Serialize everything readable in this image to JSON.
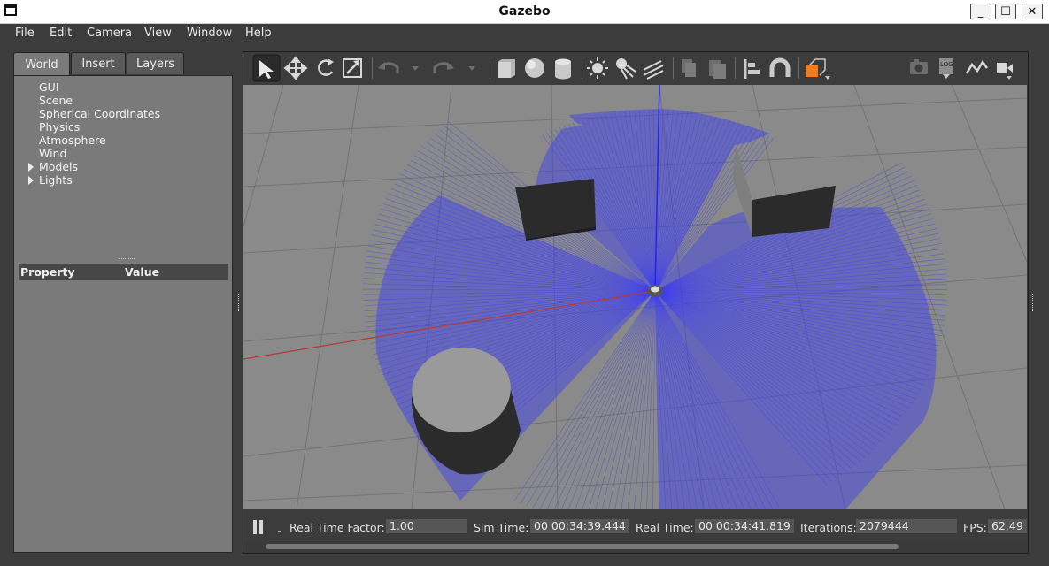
{
  "window": {
    "title": "Gazebo",
    "minimize_label": "_",
    "maximize_label": "☐",
    "close_label": "✕"
  },
  "menubar": {
    "items": [
      "File",
      "Edit",
      "Camera",
      "View",
      "Window",
      "Help"
    ]
  },
  "left_panel": {
    "tabs": [
      "World",
      "Insert",
      "Layers"
    ],
    "active_tab": "World",
    "tree": [
      "GUI",
      "Scene",
      "Spherical Coordinates",
      "Physics",
      "Atmosphere",
      "Wind",
      "Models",
      "Lights"
    ],
    "property_header": {
      "property": "Property",
      "value": "Value"
    }
  },
  "toolbar": {
    "tools": [
      "select-arrow-icon",
      "translate-icon",
      "rotate-icon",
      "scale-icon",
      "undo-icon",
      "undo-history-icon",
      "redo-icon",
      "redo-history-icon",
      "box-icon",
      "sphere-icon",
      "cylinder-icon",
      "point-light-icon",
      "spot-light-icon",
      "directional-light-icon",
      "copy-icon",
      "paste-icon",
      "align-icon",
      "snap-magnet-icon",
      "view-angle-icon",
      "screenshot-icon",
      "log-icon",
      "plot-icon",
      "video-record-icon"
    ],
    "log_label": "LOG"
  },
  "status": {
    "real_time_factor_label": "Real Time Factor:",
    "real_time_factor": "1.00",
    "sim_time_label": "Sim Time:",
    "sim_time": "00 00:34:39.444",
    "real_time_label": "Real Time:",
    "real_time": "00 00:34:41.819",
    "iterations_label": "Iterations:",
    "iterations": "2079444",
    "fps_label": "FPS:",
    "fps": "62.49"
  },
  "colors": {
    "laser": "#3b3bf5",
    "ground": "#8a8a8a",
    "grid": "#6e6e6e",
    "accent_orange": "#f07d1e"
  }
}
